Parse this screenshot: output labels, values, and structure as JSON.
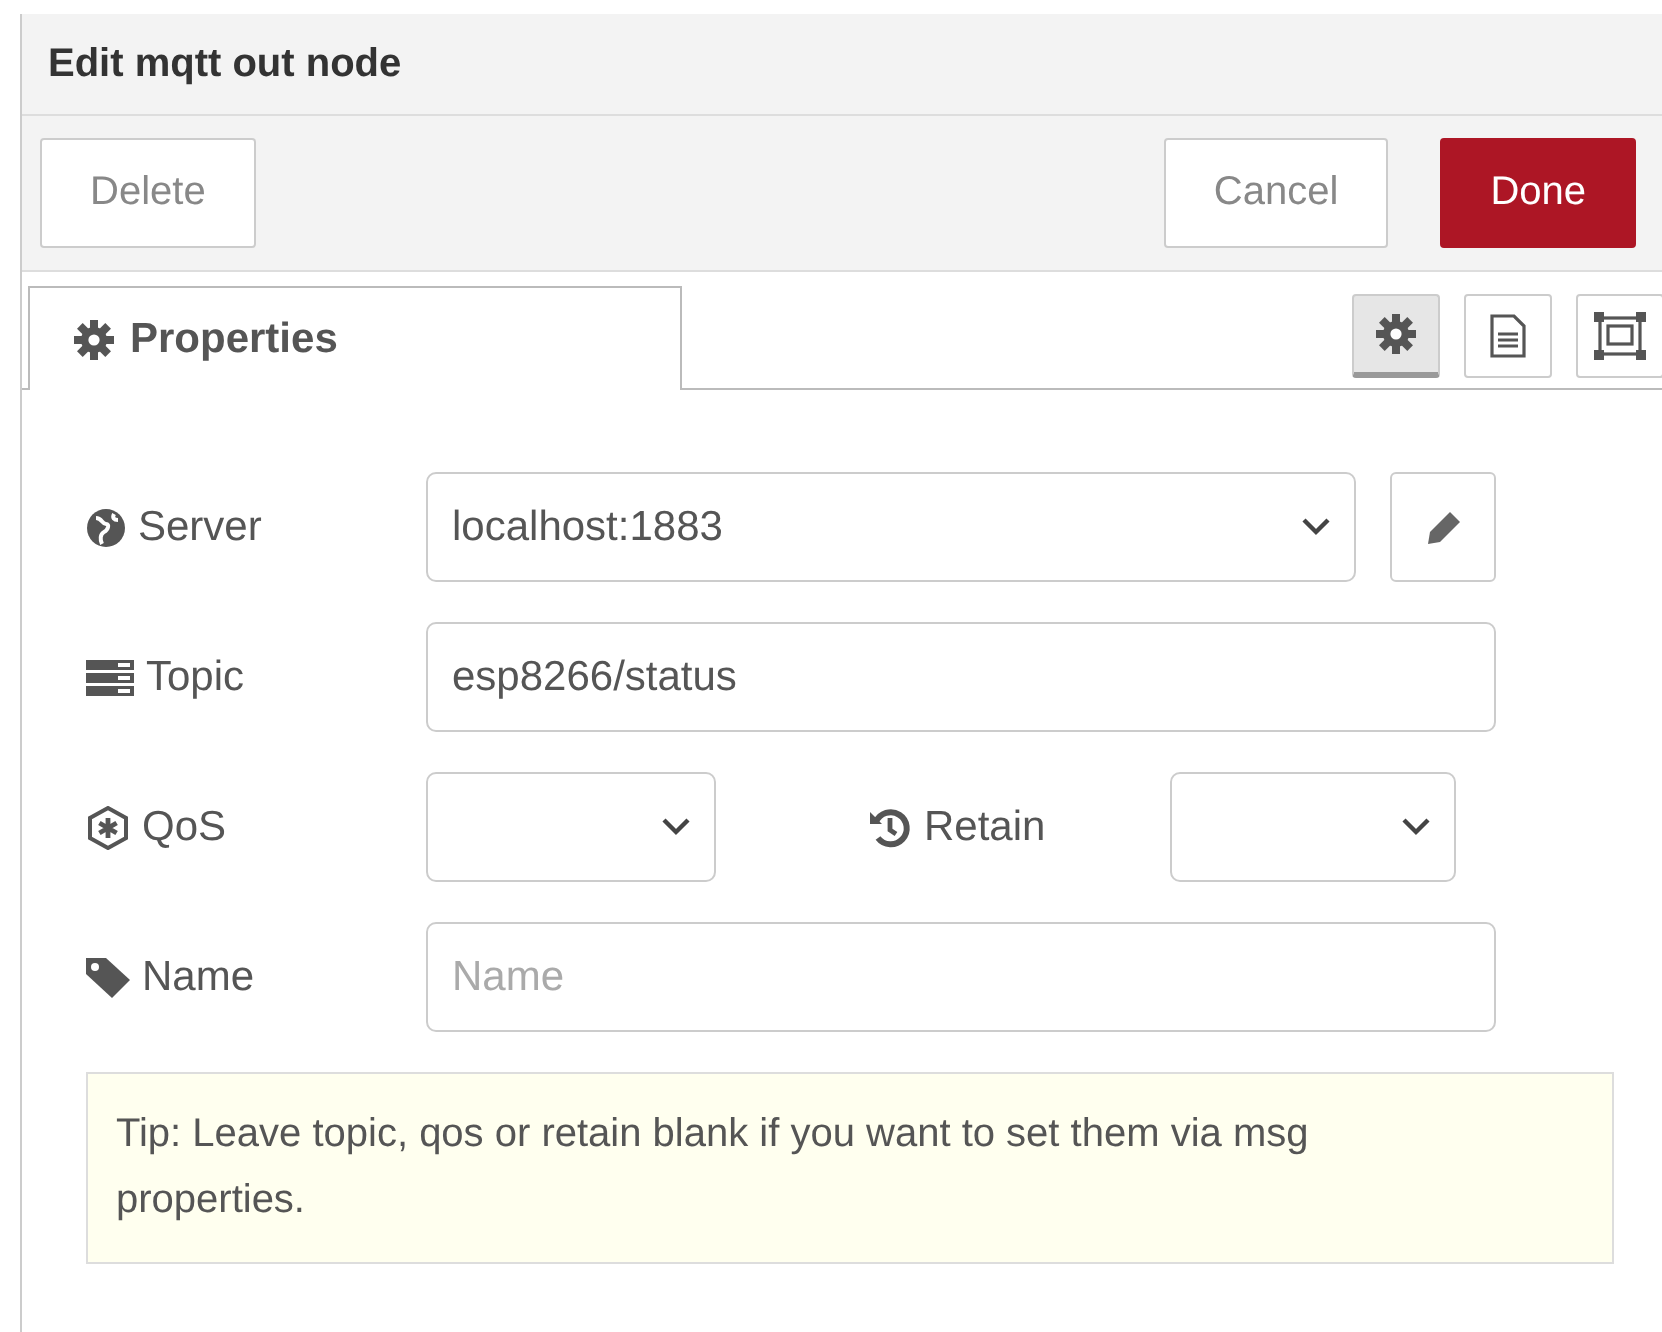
{
  "window": {
    "title": "Edit mqtt out node"
  },
  "toolbar": [
    {
      "label": "Delete",
      "kind": "secondary"
    },
    {
      "label": "Cancel",
      "kind": "secondary"
    },
    {
      "label": "Done",
      "kind": "primary"
    }
  ],
  "tabs": [
    {
      "label": "Properties",
      "selected": true
    }
  ],
  "tab_icons": [
    {
      "kind": "gear",
      "selected": true
    },
    {
      "kind": "document",
      "selected": false
    },
    {
      "kind": "frame",
      "selected": false
    }
  ],
  "form": [
    {
      "label": "Server",
      "field": {
        "kind": "select",
        "value": "localhost:1883",
        "edit_button": true
      }
    },
    {
      "label": "Topic",
      "field": {
        "kind": "text",
        "value": "esp8266/status"
      }
    },
    {
      "label": "QoS",
      "field": {
        "kind": "select"
      },
      "second": {
        "label": "Retain",
        "field": {
          "kind": "select"
        }
      }
    },
    {
      "label": "Name",
      "field": {
        "kind": "text",
        "placeholder": "Name"
      }
    }
  ],
  "tip": "Tip: Leave topic, qos or retain blank if you want to set them via msg properties."
}
